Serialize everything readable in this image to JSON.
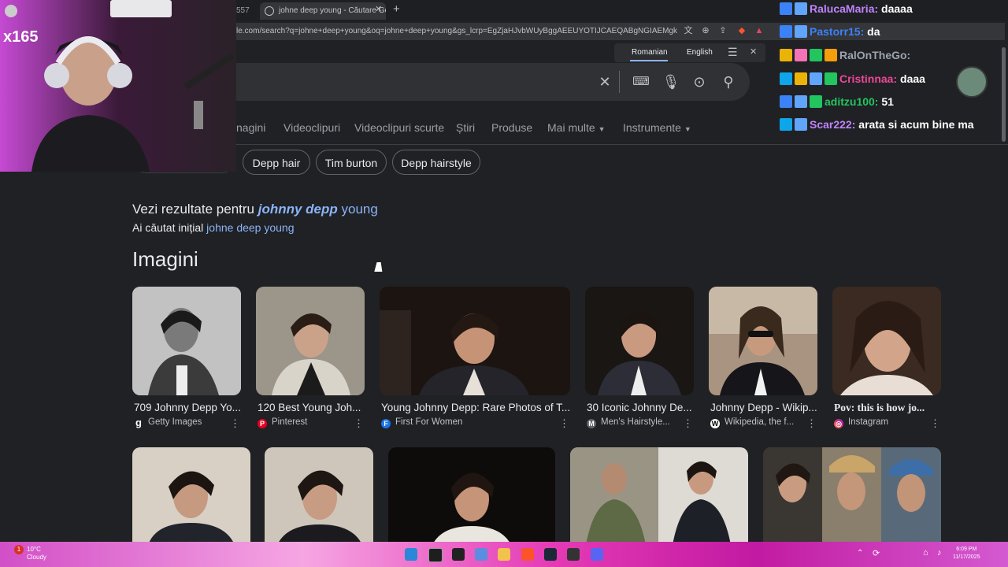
{
  "browser": {
    "tabs": [
      {
        "label": "557",
        "active": false
      },
      {
        "label": "johne deep young - Căutare Go",
        "active": true
      }
    ],
    "url": "le.com/search?q=johne+deep+young&oq=johne+deep+young&gs_lcrp=EgZjaHJvbWUyBggAEEUYOTIJCAEQABgNGIAEMgkIAhAAG..."
  },
  "translate": {
    "lang1": "Romanian",
    "lang2": "English"
  },
  "filters": {
    "tabs": [
      "nagini",
      "Videoclipuri",
      "Videoclipuri scurte",
      "Știri",
      "Produse",
      "Mai multe",
      "Instrumente"
    ],
    "chips": [
      "Depp hair",
      "Tim burton",
      "Depp hairstyle"
    ]
  },
  "spelling": {
    "see_prefix": "Vezi rezultate pentru",
    "corrected_bold": "johnny depp",
    "corrected_rest": "young",
    "searched_prefix": "Ai căutat inițial",
    "original_query": "johne deep young"
  },
  "images_heading": "Imagini",
  "images": [
    {
      "title": "709 Johnny Depp Yo...",
      "source": "Getty Images",
      "source_icon": "g"
    },
    {
      "title": "120 Best Young Joh...",
      "source": "Pinterest",
      "source_icon": "P"
    },
    {
      "title": "Young Johnny Depp: Rare Photos of T...",
      "source": "First For Women",
      "source_icon": "F"
    },
    {
      "title": "30 Iconic Johnny De...",
      "source": "Men's Hairstyle...",
      "source_icon": "M"
    },
    {
      "title": "Johnny Depp - Wikip...",
      "source": "Wikipedia, the f...",
      "source_icon": "W"
    },
    {
      "title": "Pov: this is how jo...",
      "source": "Instagram",
      "source_icon": "I"
    }
  ],
  "overlay": {
    "multiplier": "x165"
  },
  "chat": [
    {
      "name": "RalucaMaria:",
      "msg": "daaaa",
      "color": "#c084fc"
    },
    {
      "name": "Pastorr15:",
      "msg": "da",
      "color": "#3b82f6"
    },
    {
      "name": "RalOnTheGo:",
      "msg": "",
      "color": "#9ca3af"
    },
    {
      "name": "Cristinnaa:",
      "msg": "daaa",
      "color": "#ec4899"
    },
    {
      "name": "aditzu100:",
      "msg": "51",
      "color": "#22c55e"
    },
    {
      "name": "Scar222:",
      "msg": "arata si acum bine ma",
      "color": "#c084fc"
    }
  ],
  "taskbar": {
    "temp": "10°C",
    "weather": "Cloudy",
    "time": "6:09 PM",
    "date": "11/17/2025",
    "notif": "1"
  }
}
